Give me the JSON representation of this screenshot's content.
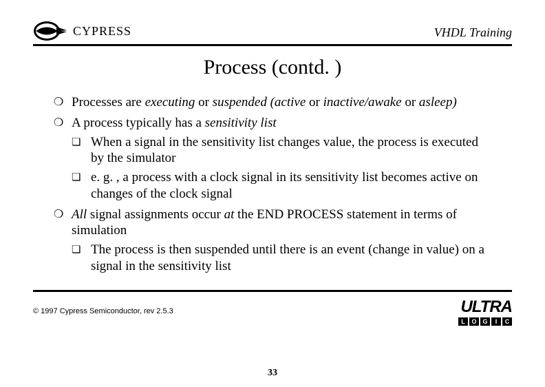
{
  "header": {
    "company": "CYPRESS",
    "topic": "VHDL Training"
  },
  "title": "Process (contd. )",
  "bullets": [
    {
      "segments": [
        {
          "t": "Processes are "
        },
        {
          "t": "executing",
          "i": true
        },
        {
          "t": " or "
        },
        {
          "t": "suspended (active",
          "i": true
        },
        {
          "t": " or "
        },
        {
          "t": "inactive/awake",
          "i": true
        },
        {
          "t": " or "
        },
        {
          "t": "asleep)",
          "i": true
        }
      ]
    },
    {
      "segments": [
        {
          "t": "A process typically has a "
        },
        {
          "t": "sensitivity list",
          "i": true
        }
      ],
      "children": [
        {
          "segments": [
            {
              "t": "When a signal in the sensitivity list changes value, the process is executed by the simulator"
            }
          ]
        },
        {
          "segments": [
            {
              "t": "e. g. , a process with a clock signal in its sensitivity list becomes active on changes of the clock signal"
            }
          ]
        }
      ]
    },
    {
      "segments": [
        {
          "t": "All",
          "i": true
        },
        {
          "t": " signal assignments occur "
        },
        {
          "t": "at",
          "i": true
        },
        {
          "t": " the END PROCESS statement in terms of simulation"
        }
      ],
      "children": [
        {
          "segments": [
            {
              "t": "The process is then suspended until there is an event (change in value) on a signal in the sensitivity list"
            }
          ]
        }
      ]
    }
  ],
  "footer": {
    "copyright": "© 1997 Cypress Semiconductor, rev 2.5.3",
    "page_number": "33",
    "brand_word": "ULTRA",
    "brand_boxes": [
      "L",
      "O",
      "G",
      "I",
      "C"
    ]
  }
}
